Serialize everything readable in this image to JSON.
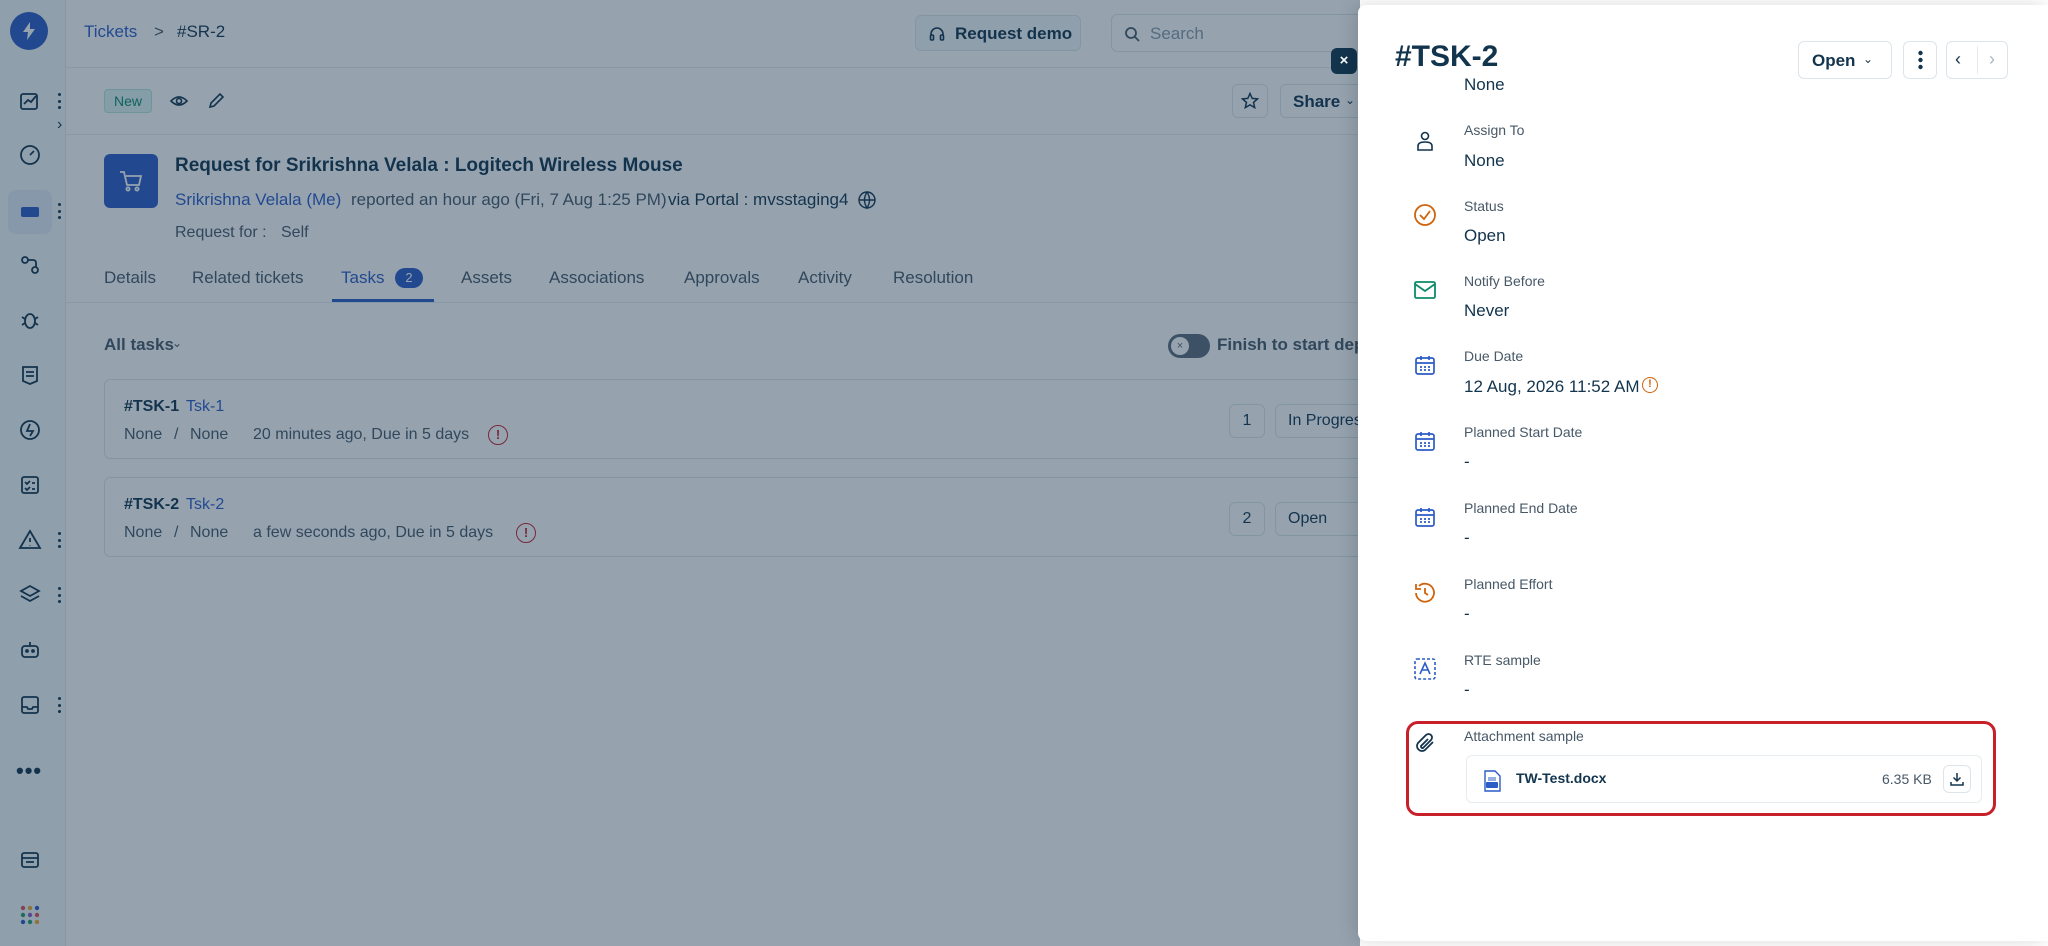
{
  "topbar": {
    "breadcrumb_root": "Tickets",
    "breadcrumb_sep": ">",
    "breadcrumb_current": "#SR-2",
    "request_demo": "Request demo",
    "search_placeholder": "Search"
  },
  "ticket": {
    "status_badge": "New",
    "share": "Share",
    "title": "Request for Srikrishna Velala : Logitech Wireless Mouse",
    "requester": "Srikrishna Velala (Me)",
    "reported": "reported an hour ago (Fri, 7 Aug 1:25 PM)",
    "via": "via Portal : mvsstaging4",
    "request_for_label": "Request for :",
    "request_for_value": "Self",
    "tasks_count": "2",
    "tabs": [
      "Details",
      "Related tickets",
      "Tasks",
      "Assets",
      "Associations",
      "Approvals",
      "Activity",
      "Resolution"
    ]
  },
  "tasks_view": {
    "filter": "All tasks",
    "toggle_label": "Finish to start dep",
    "tasks": [
      {
        "id": "#TSK-1",
        "name": "Tsk-1",
        "meta_a": "None",
        "sep": "/",
        "meta_b": "None",
        "time": "20 minutes ago, Due in 5 days",
        "num": "1",
        "status": "In Progres"
      },
      {
        "id": "#TSK-2",
        "name": "Tsk-2",
        "meta_a": "None",
        "sep": "/",
        "meta_b": "None",
        "time": "a few seconds ago, Due in 5 days",
        "num": "2",
        "status": "Open"
      }
    ]
  },
  "panel": {
    "title": "#TSK-2",
    "status_button": "Open",
    "top_value": "None",
    "fields": [
      {
        "label": "Assign To",
        "value": "None",
        "icon": "person-icon"
      },
      {
        "label": "Status",
        "value": "Open",
        "icon": "check-circle-icon"
      },
      {
        "label": "Notify Before",
        "value": "Never",
        "icon": "mail-icon"
      },
      {
        "label": "Due Date",
        "value": "12 Aug, 2026 11:52 AM",
        "icon": "calendar-icon"
      },
      {
        "label": "Planned Start Date",
        "value": "-",
        "icon": "calendar-icon"
      },
      {
        "label": "Planned End Date",
        "value": "-",
        "icon": "calendar-icon"
      },
      {
        "label": "Planned Effort",
        "value": "-",
        "icon": "clock-history-icon"
      },
      {
        "label": "RTE sample",
        "value": "-",
        "icon": "text-box-icon"
      }
    ],
    "attachment": {
      "label": "Attachment sample",
      "file_name": "TW-Test.docx",
      "file_size": "6.35 KB"
    }
  },
  "colors": {
    "accent": "#2c5cc5",
    "highlight_border": "#c8202a",
    "overlay": "#16324e",
    "orange_icon": "#d0640c",
    "green_icon": "#0d8a6b"
  }
}
